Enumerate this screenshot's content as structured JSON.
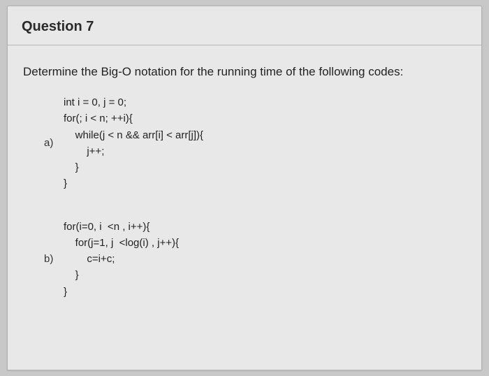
{
  "header": {
    "title": "Question 7"
  },
  "prompt": "Determine the Big-O notation for the running time of the following codes:",
  "parts": [
    {
      "label": "a)",
      "code": "int i = 0, j = 0;\nfor(; i < n; ++i){\n    while(j < n && arr[i] < arr[j]){\n        j++;\n    }\n}"
    },
    {
      "label": "b)",
      "code": "for(i=0, i  <n , i++){\n    for(j=1, j  <log(i) , j++){\n        c=i+c;\n    }\n}"
    }
  ]
}
